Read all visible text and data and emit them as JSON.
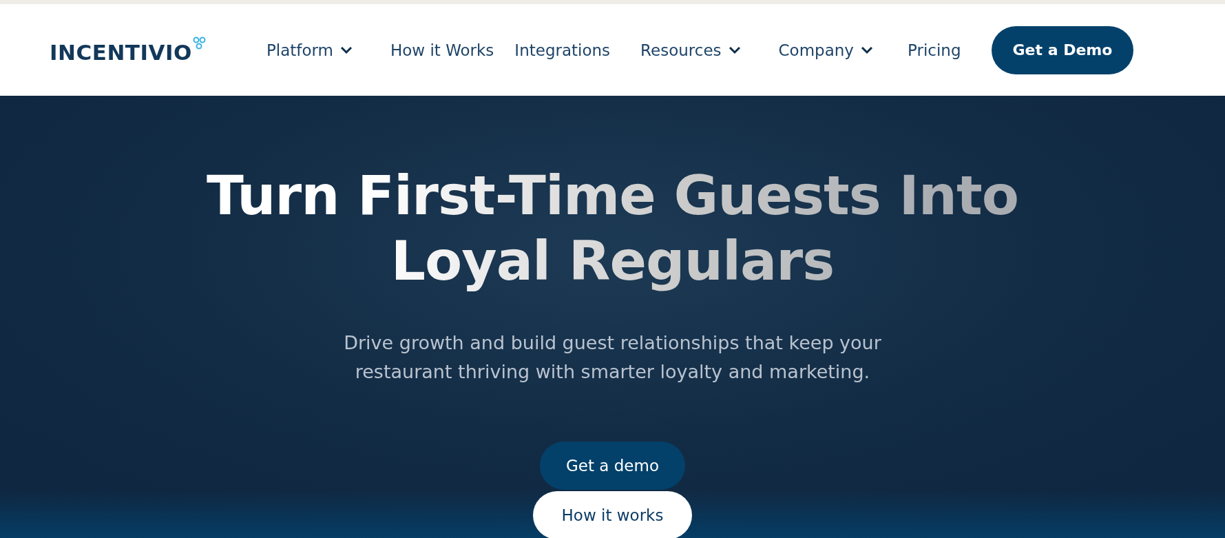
{
  "header": {
    "logo": "INCENTIVIO",
    "nav": [
      {
        "label": "Platform",
        "has_menu": true
      },
      {
        "label": "How it Works",
        "has_menu": false
      },
      {
        "label": "Integrations",
        "has_menu": false
      },
      {
        "label": "Resources",
        "has_menu": true
      },
      {
        "label": "Company",
        "has_menu": true
      },
      {
        "label": "Pricing",
        "has_menu": false
      }
    ],
    "cta": "Get a Demo"
  },
  "hero": {
    "title_lines": [
      "Turn First-Time Guests Into",
      "Loyal Regulars"
    ],
    "subtitle_lines": [
      "Drive growth and build guest relationships that keep your",
      "restaurant thriving with smarter loyalty and marketing."
    ],
    "buttons": [
      {
        "label": "Get a demo",
        "kind": "primary"
      },
      {
        "label": "How it works",
        "kind": "secondary"
      }
    ]
  }
}
